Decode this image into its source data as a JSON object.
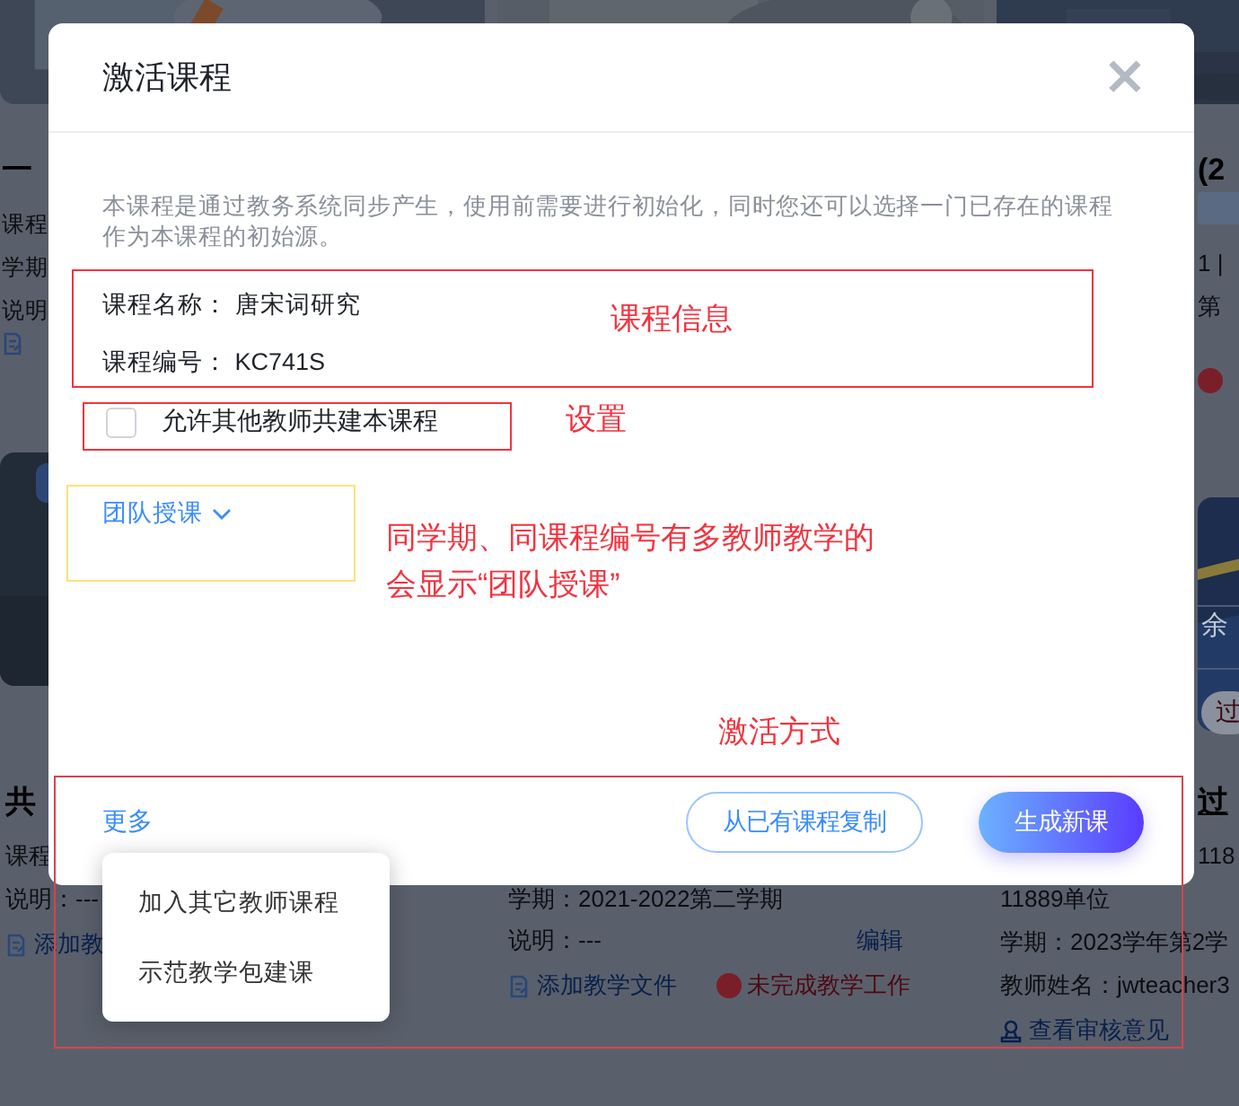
{
  "background": {
    "top_left_card": {
      "title": "一",
      "lines": [
        "课程",
        "学期",
        "说明"
      ]
    },
    "top_right_card": {
      "title": "(2",
      "lines": [
        "1 |",
        "第"
      ]
    },
    "banner": {
      "text": "余",
      "button": "过"
    },
    "bottom_cards": [
      {
        "title": "共",
        "lines": [
          "课程",
          "说明：---"
        ],
        "link": "添加教"
      },
      {
        "lines": [
          "学期：2021-2022第二学期",
          "说明：---"
        ],
        "edit": "编辑",
        "link": "添加教学文件",
        "warning": "未完成教学工作"
      },
      {
        "title": "过",
        "lines": [
          "118",
          "11889单位",
          "学期：2023学年第2学",
          "教师姓名：jwteacher3"
        ],
        "link": "查看审核意见"
      }
    ]
  },
  "dialog": {
    "title": "激活课程",
    "close": "×",
    "description": "本课程是通过教务系统同步产生，使用前需要进行初始化，同时您还可以选择一门已存在的课程作为本课程的初始源。",
    "fields": [
      {
        "label": "课程名称：",
        "value": "唐宋词研究"
      },
      {
        "label": "课程编号：",
        "value": "KC741S"
      }
    ],
    "share_option": {
      "label": "允许其他教师共建本课程",
      "checked": false
    },
    "team_teaching": {
      "label": "团队授课",
      "expanded": false
    },
    "more": "更多",
    "buttons": [
      {
        "label": "从已有课程复制",
        "kind": "outline"
      },
      {
        "label": "生成新课",
        "kind": "primary"
      }
    ]
  },
  "more_menu": {
    "items": [
      "加入其它教师课程",
      "示范教学包建课"
    ]
  },
  "annotations": [
    {
      "label": "课程信息",
      "color": "#f2333f"
    },
    {
      "label": "设置",
      "color": "#f2333f"
    },
    {
      "label": "同学期、同课程编号有多教师教学的会显示“团队授课”",
      "color": "#ffe27a"
    },
    {
      "label": "激活方式",
      "color": "#d9434f"
    }
  ]
}
